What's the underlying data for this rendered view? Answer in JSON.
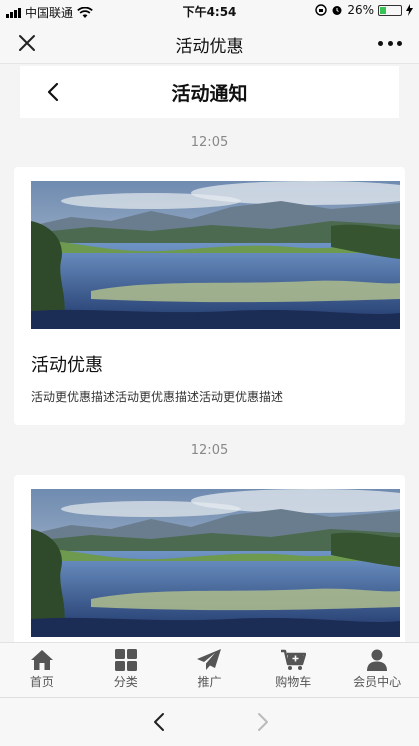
{
  "status_bar": {
    "carrier": "中国联通",
    "time": "下午4:54",
    "battery_percent": "26%",
    "battery_level": 0.26,
    "battery_color": "#37c455"
  },
  "wx_nav": {
    "title": "活动优惠",
    "close_icon": "close-icon",
    "more_icon": "more-dots-icon"
  },
  "page_header": {
    "title": "活动通知",
    "back_icon": "chevron-left-icon"
  },
  "messages": [
    {
      "timestamp": "12:05",
      "title": "活动优惠",
      "description": "活动更优惠描述活动更优惠描述活动更优惠描述",
      "image": "lake-landscape-photo"
    },
    {
      "timestamp": "12:05",
      "image": "lake-landscape-photo"
    }
  ],
  "tabbar": {
    "items": [
      {
        "label": "首页",
        "icon": "home-icon"
      },
      {
        "label": "分类",
        "icon": "grid-icon"
      },
      {
        "label": "推广",
        "icon": "paper-plane-icon"
      },
      {
        "label": "购物车",
        "icon": "cart-icon"
      },
      {
        "label": "会员中心",
        "icon": "user-icon"
      }
    ]
  },
  "browser_bar": {
    "back_icon": "chevron-left-icon",
    "forward_icon": "chevron-right-icon"
  }
}
